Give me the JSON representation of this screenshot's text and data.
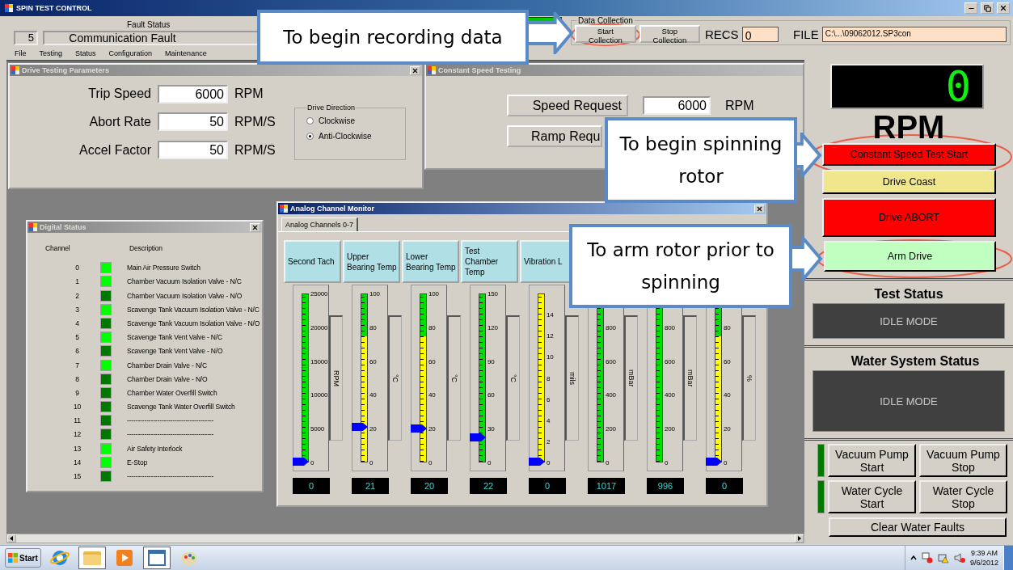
{
  "window": {
    "title": "SPIN TEST CONTROL"
  },
  "fault_status": {
    "label": "Fault Status",
    "code": "5",
    "message": "Communication Fault",
    "indicator_on": true
  },
  "data_collection": {
    "label": "Data Collection",
    "buttons": [
      "Start Collection",
      "Stop Collection"
    ],
    "recs_label": "RECS",
    "recs_value": "0",
    "file_label": "FILE",
    "file_value": "C:\\...\\09062012.SP3con"
  },
  "menu": [
    "File",
    "Testing",
    "Status",
    "Configuration",
    "Maintenance"
  ],
  "drive_params": {
    "title": "Drive Testing Parameters",
    "fields": [
      {
        "label": "Trip Speed",
        "value": "6000",
        "unit": "RPM"
      },
      {
        "label": "Abort Rate",
        "value": "50",
        "unit": "RPM/S"
      },
      {
        "label": "Accel Factor",
        "value": "50",
        "unit": "RPM/S"
      }
    ],
    "direction": {
      "label": "Drive Direction",
      "options": [
        {
          "label": "Clockwise",
          "selected": false
        },
        {
          "label": "Anti-Clockwise",
          "selected": true
        }
      ]
    }
  },
  "constant_speed": {
    "title": "Constant Speed Testing",
    "speed_button": "Speed Request",
    "speed_value": "6000",
    "speed_unit": "RPM",
    "ramp_button": "Ramp Requ"
  },
  "digital_status": {
    "title": "Digital Status",
    "columns": [
      "Channel",
      "Description"
    ],
    "rows": [
      {
        "channel": "0",
        "on": true,
        "description": "Main Air Pressure Switch"
      },
      {
        "channel": "1",
        "on": true,
        "description": "Chamber Vacuum Isolation Valve - N/C"
      },
      {
        "channel": "2",
        "on": false,
        "description": "Chamber Vacuum Isolation Valve - N/O"
      },
      {
        "channel": "3",
        "on": true,
        "description": "Scavenge Tank Vacuum Isolation Valve - N/C"
      },
      {
        "channel": "4",
        "on": false,
        "description": "Scavenge Tank Vacuum Isolation Valve - N/O"
      },
      {
        "channel": "5",
        "on": true,
        "description": "Scavenge Tank Vent Valve - N/C"
      },
      {
        "channel": "6",
        "on": false,
        "description": "Scavenge Tank Vent Valve - N/O"
      },
      {
        "channel": "7",
        "on": true,
        "description": "Chamber Drain Valve - N/C"
      },
      {
        "channel": "8",
        "on": false,
        "description": "Chamber Drain Valve - N/O"
      },
      {
        "channel": "9",
        "on": false,
        "description": "Chamber Water Overfill Switch"
      },
      {
        "channel": "10",
        "on": false,
        "description": "Scavenge Tank Water Overfill Switch"
      },
      {
        "channel": "11",
        "on": false,
        "description": "----------------------------------------"
      },
      {
        "channel": "12",
        "on": false,
        "description": "----------------------------------------"
      },
      {
        "channel": "13",
        "on": true,
        "description": "Air Safety Interlock"
      },
      {
        "channel": "14",
        "on": true,
        "description": "E-Stop"
      },
      {
        "channel": "15",
        "on": false,
        "description": "----------------------------------------"
      }
    ]
  },
  "analog_monitor": {
    "title": "Analog Channel Monitor",
    "tab": "Analog Channels 0-7",
    "channels": [
      {
        "name": "Second Tach",
        "kind": "green",
        "ticks": [
          "25000",
          "20000",
          "15000",
          "10000",
          "5000",
          "0"
        ],
        "unit": "RPM",
        "level": 0,
        "reading": "0"
      },
      {
        "name": "Upper Bearing Temp",
        "kind": "split",
        "ticks": [
          "100",
          "80",
          "60",
          "40",
          "20",
          "0"
        ],
        "unit": "°C",
        "level": 0.21,
        "reading": "21"
      },
      {
        "name": "Lower Bearing Temp",
        "kind": "split",
        "ticks": [
          "100",
          "80",
          "60",
          "40",
          "20",
          "0"
        ],
        "unit": "°C",
        "level": 0.2,
        "reading": "20"
      },
      {
        "name": "Test Chamber Temp",
        "kind": "green",
        "ticks": [
          "150",
          "120",
          "90",
          "60",
          "30",
          "0"
        ],
        "unit": "°C",
        "level": 0.147,
        "reading": "22"
      },
      {
        "name": "Vibration L",
        "kind": "yellow",
        "top_hidden": true,
        "ticks": [
          "14",
          "12",
          "10",
          "8",
          "6",
          "4",
          "2",
          "0"
        ],
        "unit": "mils",
        "level": 0,
        "reading": "0"
      },
      {
        "kind": "green",
        "top_hidden": true,
        "ticks": [
          "800",
          "600",
          "400",
          "200",
          "0"
        ],
        "unit": "mBar",
        "reading": "1017"
      },
      {
        "kind": "green",
        "top_hidden": true,
        "ticks": [
          "800",
          "600",
          "400",
          "200",
          "0"
        ],
        "unit": "mBar",
        "reading": "996"
      },
      {
        "kind": "split",
        "top_hidden": true,
        "ticks": [
          "80",
          "60",
          "40",
          "20",
          "0"
        ],
        "unit": "%",
        "level": 0,
        "reading": "0"
      }
    ]
  },
  "rpm_display": {
    "digit": "0",
    "label": "RPM"
  },
  "drive_buttons": [
    {
      "label": "Constant Speed Test Start",
      "kind": "start"
    },
    {
      "label": "Drive Coast",
      "kind": "coast"
    },
    {
      "label": "Drive ABORT",
      "kind": "abort"
    },
    {
      "label": "Arm Drive",
      "kind": "arm"
    }
  ],
  "test_status": {
    "title": "Test Status",
    "value": "IDLE MODE"
  },
  "water_status": {
    "title": "Water System Status",
    "value": "IDLE MODE"
  },
  "pump_controls": [
    {
      "on": false,
      "buttons": [
        "Vacuum Pump Start",
        "Vacuum Pump Stop"
      ]
    },
    {
      "on": false,
      "buttons": [
        "Water Cycle Start",
        "Water Cycle Stop"
      ]
    }
  ],
  "clear_button": "Clear Water Faults",
  "taskbar": {
    "start": "Start",
    "time": "9:39 AM",
    "date": "9/6/2012"
  },
  "callouts": [
    {
      "text": "To begin recording data"
    },
    {
      "text": "To begin spinning rotor"
    },
    {
      "text": "To arm rotor prior to spinning"
    }
  ]
}
